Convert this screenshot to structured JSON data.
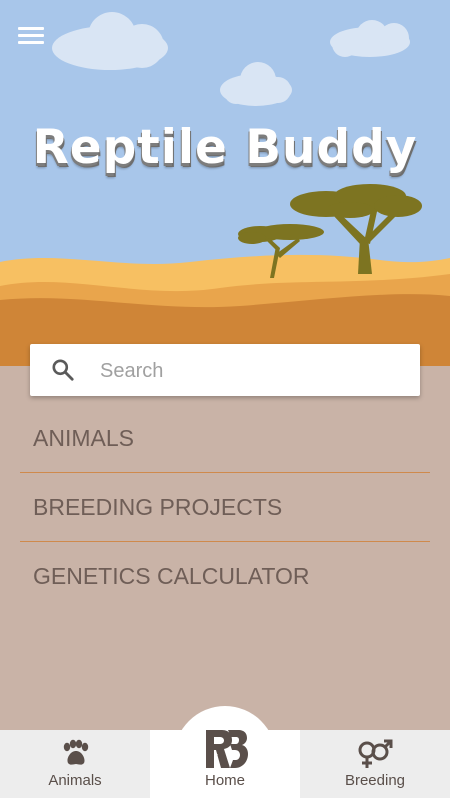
{
  "header": {
    "title": "Reptile Buddy",
    "menu_icon": "hamburger-menu-icon"
  },
  "search": {
    "placeholder": "Search",
    "value": "",
    "icon": "search-icon"
  },
  "menu": {
    "items": [
      {
        "label": "ANIMALS"
      },
      {
        "label": "BREEDING PROJECTS"
      },
      {
        "label": "GENETICS CALCULATOR"
      }
    ]
  },
  "bottom_nav": {
    "items": [
      {
        "label": "Animals",
        "icon": "paw-icon"
      },
      {
        "label": "Home",
        "icon": "rb-logo-icon",
        "active": true
      },
      {
        "label": "Breeding",
        "icon": "gender-symbols-icon"
      }
    ]
  },
  "colors": {
    "sky": "#a8c6ea",
    "sand_light": "#f2b457",
    "sand_dark": "#cf8537",
    "body_bg": "#c9b3a7",
    "divider": "#cf8a4c",
    "menu_text": "#6f5e57",
    "tree": "#7d7421"
  }
}
